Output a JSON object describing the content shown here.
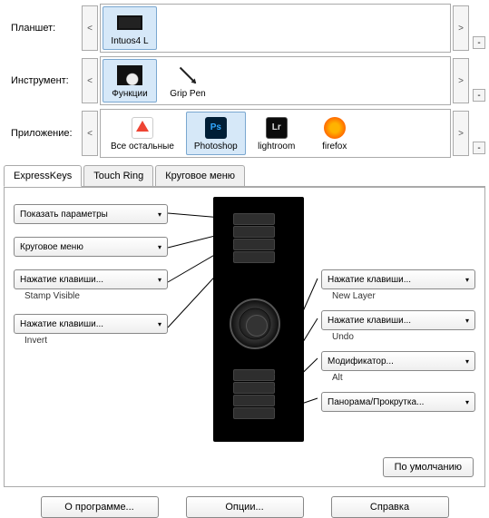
{
  "rows": {
    "tablet": {
      "label": "Планшет:",
      "items": [
        {
          "label": "Intuos4  L",
          "icon": "tablet-icon",
          "selected": true
        }
      ]
    },
    "tool": {
      "label": "Инструмент:",
      "items": [
        {
          "label": "Функции",
          "icon": "functions-icon",
          "selected": true
        },
        {
          "label": "Grip Pen",
          "icon": "pen-icon",
          "selected": false
        }
      ]
    },
    "app": {
      "label": "Приложение:",
      "items": [
        {
          "label": "Все остальные",
          "icon": "all-apps-icon",
          "selected": false
        },
        {
          "label": "Photoshop",
          "icon": "photoshop-icon",
          "selected": true
        },
        {
          "label": "lightroom",
          "icon": "lightroom-icon",
          "selected": false
        },
        {
          "label": "firefox",
          "icon": "firefox-icon",
          "selected": false
        }
      ]
    }
  },
  "tabs": [
    {
      "label": "ExpressKeys",
      "active": true
    },
    {
      "label": "Touch Ring",
      "active": false
    },
    {
      "label": "Круговое меню",
      "active": false
    }
  ],
  "express_keys": {
    "left": [
      {
        "dropdown": "Показать параметры",
        "sub": ""
      },
      {
        "dropdown": "Круговое меню",
        "sub": ""
      },
      {
        "dropdown": "Нажатие клавиши...",
        "sub": "Stamp Visible"
      },
      {
        "dropdown": "Нажатие клавиши...",
        "sub": "Invert"
      }
    ],
    "right": [
      {
        "dropdown": "Нажатие клавиши...",
        "sub": "New Layer"
      },
      {
        "dropdown": "Нажатие клавиши...",
        "sub": "Undo"
      },
      {
        "dropdown": "Модификатор...",
        "sub": "Alt"
      },
      {
        "dropdown": "Панорама/Прокрутка...",
        "sub": ""
      }
    ],
    "default_button": "По умолчанию"
  },
  "footer": {
    "about": "О программе...",
    "options": "Опции...",
    "help": "Справка"
  }
}
